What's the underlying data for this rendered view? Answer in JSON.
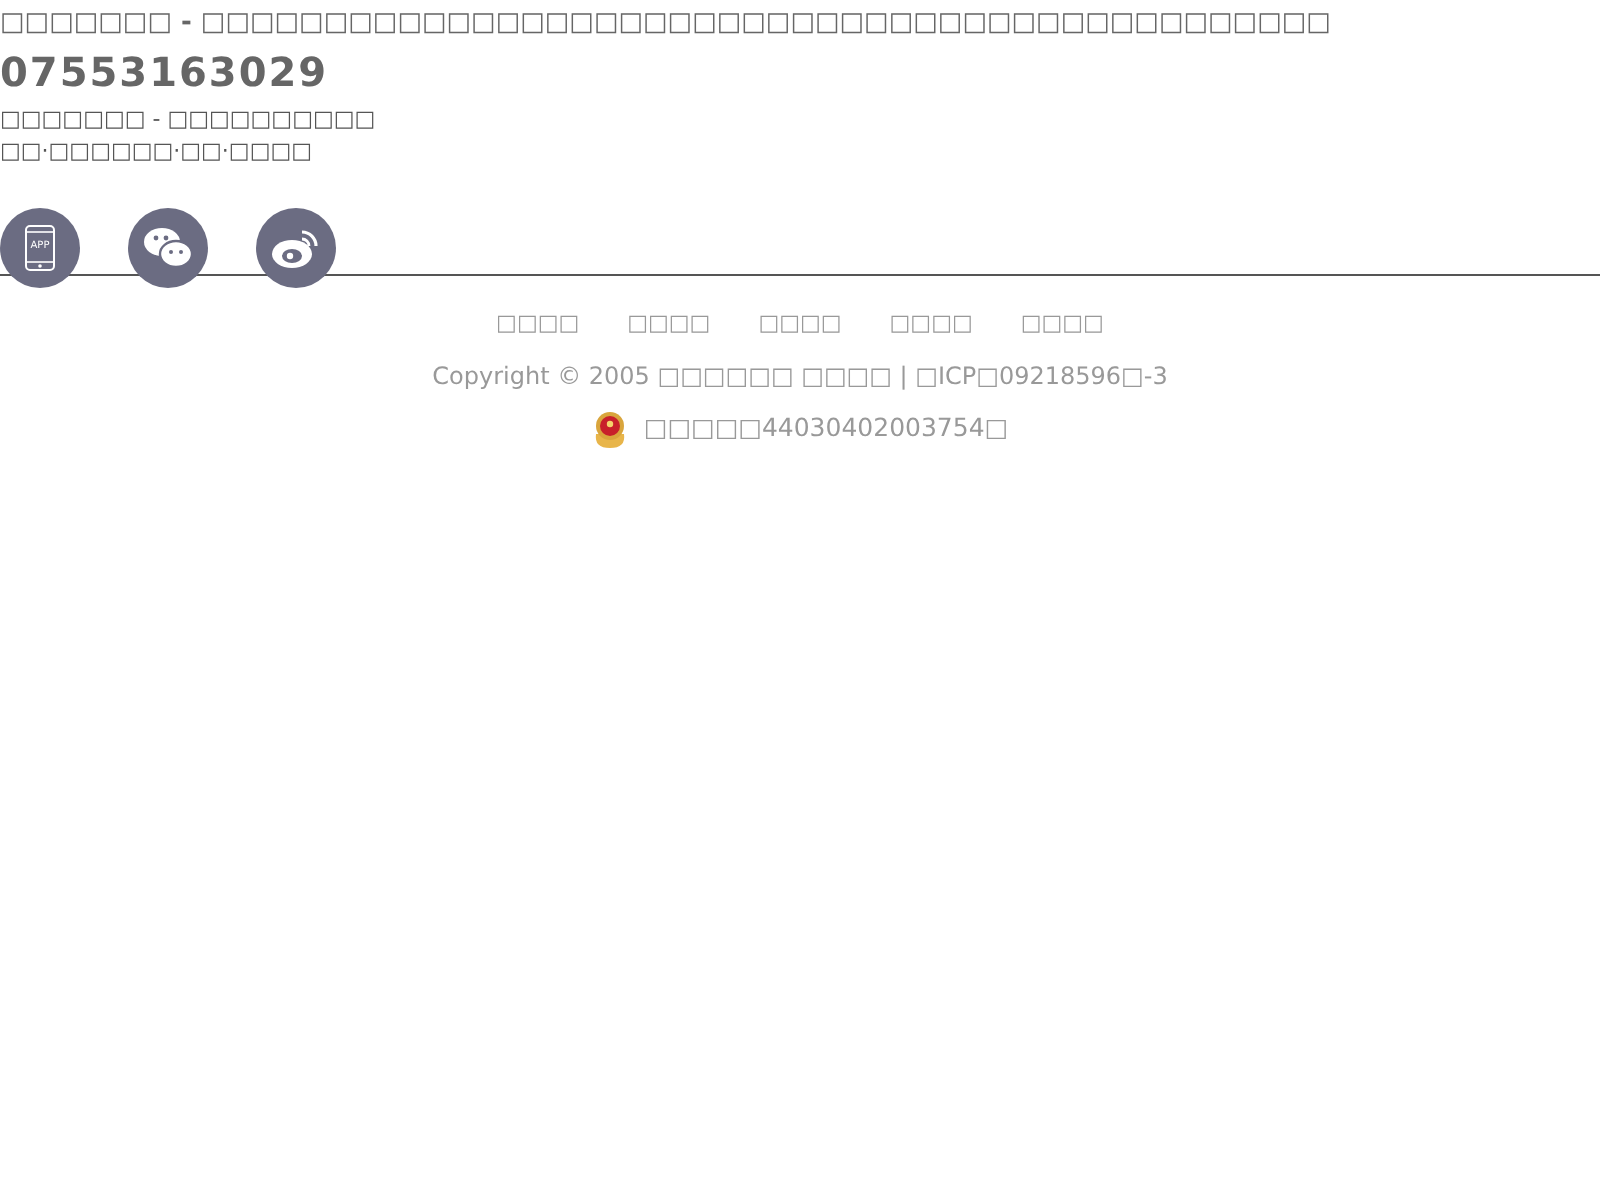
{
  "header": {
    "title": "□□□□□□□ - □□□□□□□□□□□□□□□□□□□□□□□□□□□□□□□□□□□□□□□□□□□□□□",
    "phone": "07553163029",
    "tagline": "□□□□□□□ - □□□□□□□□□□",
    "slogan": "□□·□□□□□□·□□·□□□□"
  },
  "social": [
    {
      "kind": "app",
      "label": "APP"
    },
    {
      "kind": "wechat"
    },
    {
      "kind": "weibo"
    }
  ],
  "footer": {
    "links": [
      "□□□□",
      "□□□□",
      "□□□□",
      "□□□□",
      "□□□□"
    ],
    "copyright": "Copyright © 2005 □□□□□□ □□□□ | □ICP□09218596□-3",
    "police": "□□□□□44030402003754□"
  }
}
